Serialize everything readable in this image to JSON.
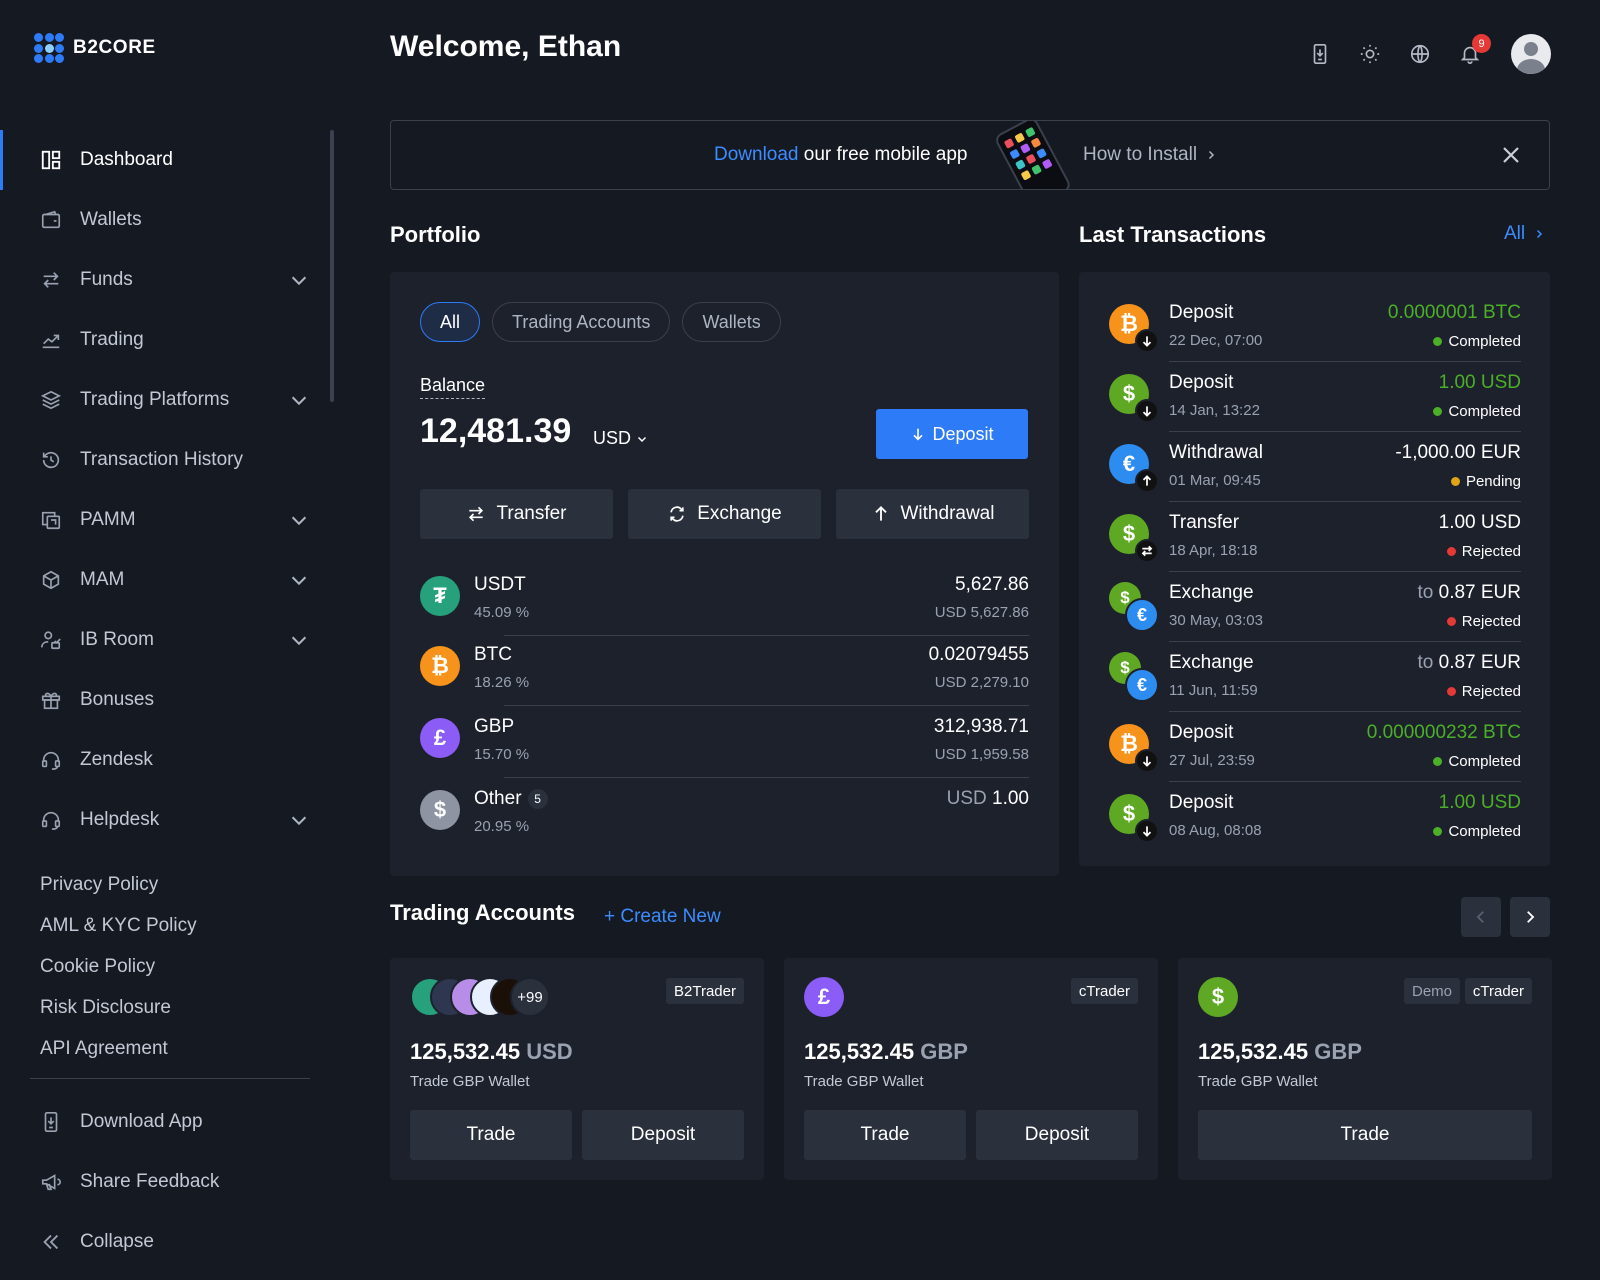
{
  "app": {
    "name": "B2CORE"
  },
  "header": {
    "welcome": "Welcome, Ethan",
    "notification_count": "9"
  },
  "sidebar": {
    "items": [
      {
        "label": "Dashboard",
        "icon": "dashboard-icon",
        "active": true
      },
      {
        "label": "Wallets",
        "icon": "wallet-icon"
      },
      {
        "label": "Funds",
        "icon": "transfer-arrows-icon",
        "expandable": true
      },
      {
        "label": "Trading",
        "icon": "chart-line-icon"
      },
      {
        "label": "Trading Platforms",
        "icon": "layers-icon",
        "expandable": true
      },
      {
        "label": "Transaction History",
        "icon": "history-icon"
      },
      {
        "label": "PAMM",
        "icon": "copy-icon",
        "expandable": true
      },
      {
        "label": "MAM",
        "icon": "cube-icon",
        "expandable": true
      },
      {
        "label": "IB Room",
        "icon": "users-icon",
        "expandable": true
      },
      {
        "label": "Bonuses",
        "icon": "gift-icon"
      },
      {
        "label": "Zendesk",
        "icon": "headset-icon"
      },
      {
        "label": "Helpdesk",
        "icon": "headset-icon",
        "expandable": true
      }
    ],
    "policies": [
      "Privacy Policy",
      "AML & KYC Policy",
      "Cookie Policy",
      "Risk Disclosure",
      "API Agreement"
    ],
    "bottom": [
      {
        "label": "Download App",
        "icon": "download-app-icon"
      },
      {
        "label": "Share Feedback",
        "icon": "megaphone-icon"
      },
      {
        "label": "Collapse",
        "icon": "double-chevron-left-icon"
      }
    ]
  },
  "banner": {
    "link": "Download",
    "text": " our free mobile app",
    "how_to": "How to Install"
  },
  "portfolio": {
    "title": "Portfolio",
    "tabs": [
      "All",
      "Trading Accounts",
      "Wallets"
    ],
    "balance_label": "Balance",
    "balance": "12,481.39",
    "currency": "USD",
    "deposit": "Deposit",
    "actions": [
      "Transfer",
      "Exchange",
      "Withdrawal"
    ],
    "assets": [
      {
        "name": "USDT",
        "pct": "45.09 %",
        "amount": "5,627.86",
        "usd": "USD 5,627.86",
        "color": "#26a17b",
        "symbol": "₮"
      },
      {
        "name": "BTC",
        "pct": "18.26 %",
        "amount": "0.02079455",
        "usd": "USD 2,279.10",
        "color": "#f7931a",
        "symbol": "₿"
      },
      {
        "name": "GBP",
        "pct": "15.70 %",
        "amount": "312,938.71",
        "usd": "USD 1,959.58",
        "color": "#8b5cf6",
        "symbol": "£"
      },
      {
        "name": "Other",
        "count": "5",
        "pct": "20.95 %",
        "amount_prefix": "USD",
        "amount": "1.00",
        "color": "#8e94a2",
        "symbol": "$"
      }
    ]
  },
  "transactions": {
    "title": "Last Transactions",
    "all": "All",
    "items": [
      {
        "type": "Deposit",
        "date": "22 Dec, 07:00",
        "amount": "0.0000001 BTC",
        "status": "Completed",
        "coin": "btc",
        "dir": "down"
      },
      {
        "type": "Deposit",
        "date": "14 Jan, 13:22",
        "amount": "1.00 USD",
        "status": "Completed",
        "coin": "usd",
        "dir": "down"
      },
      {
        "type": "Withdrawal",
        "date": "01 Mar, 09:45",
        "amount": "-1,000.00 EUR",
        "status": "Pending",
        "coin": "eur",
        "dir": "up"
      },
      {
        "type": "Transfer",
        "date": "18 Apr, 18:18",
        "amount": "1.00 USD",
        "status": "Rejected",
        "coin": "usd",
        "dir": "swap"
      },
      {
        "type": "Exchange",
        "date": "30 May, 03:03",
        "prefix": "to",
        "amount": "0.87 EUR",
        "status": "Rejected",
        "coin": "exchange"
      },
      {
        "type": "Exchange",
        "date": "11 Jun, 11:59",
        "prefix": "to",
        "amount": "0.87 EUR",
        "status": "Rejected",
        "coin": "exchange"
      },
      {
        "type": "Deposit",
        "date": "27 Jul, 23:59",
        "amount": "0.000000232 BTC",
        "status": "Completed",
        "coin": "btc",
        "dir": "down"
      },
      {
        "type": "Deposit",
        "date": "08 Aug, 08:08",
        "amount": "1.00 USD",
        "status": "Completed",
        "coin": "usd",
        "dir": "down"
      }
    ],
    "status_colors": {
      "Completed": "#4caf28",
      "Pending": "#e0a516",
      "Rejected": "#e53935"
    }
  },
  "trading_accounts": {
    "title": "Trading Accounts",
    "create_new": "Create New",
    "cards": [
      {
        "platform": "B2Trader",
        "amount": "125,532.45",
        "currency": "USD",
        "wallet": "Trade GBP Wallet",
        "more": "+99",
        "buttons": [
          "Trade",
          "Deposit"
        ]
      },
      {
        "platform": "cTrader",
        "amount": "125,532.45",
        "currency": "GBP",
        "wallet": "Trade GBP Wallet",
        "buttons": [
          "Trade",
          "Deposit"
        ]
      },
      {
        "platform": "cTrader",
        "demo": "Demo",
        "amount": "125,532.45",
        "currency": "GBP",
        "wallet": "Trade GBP Wallet",
        "buttons": [
          "Trade"
        ]
      }
    ]
  },
  "colors": {
    "accent": "#2d7bf6",
    "background": "#151922",
    "panel": "#1c212c",
    "positive": "#4caf28"
  }
}
